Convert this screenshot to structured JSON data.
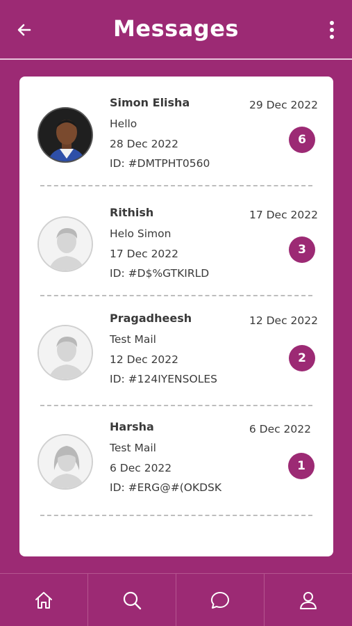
{
  "header": {
    "title": "Messages",
    "back_icon": "arrow-left-icon",
    "menu_icon": "more-vertical-icon"
  },
  "messages": [
    {
      "name": "Simon Elisha",
      "preview": "Hello",
      "sent_date": "28 Dec 2022",
      "id_text": "ID: #DMTPHT0560",
      "date": "29 Dec 2022",
      "unread": "6",
      "avatar": "photo"
    },
    {
      "name": "Rithish",
      "preview": "Helo Simon",
      "sent_date": "17 Dec 2022",
      "id_text": "ID: #D$%GTKIRLD",
      "date": "17 Dec 2022",
      "unread": "3",
      "avatar": "male-placeholder"
    },
    {
      "name": "Pragadheesh",
      "preview": "Test Mail",
      "sent_date": "12 Dec 2022",
      "id_text": "ID: #124IYENSOLES",
      "date": "12 Dec 2022",
      "unread": "2",
      "avatar": "male-placeholder"
    },
    {
      "name": "Harsha",
      "preview": "Test Mail",
      "sent_date": "6 Dec 2022",
      "id_text": "ID: #ERG@#(OKDSK",
      "date": "6 Dec 2022",
      "unread": "1",
      "avatar": "female-placeholder"
    }
  ],
  "bottom_nav": [
    {
      "icon": "home-icon"
    },
    {
      "icon": "search-icon"
    },
    {
      "icon": "chat-icon"
    },
    {
      "icon": "profile-icon"
    }
  ],
  "colors": {
    "brand": "#9c2a74",
    "card": "#ffffff",
    "text": "#3a3a3a"
  }
}
